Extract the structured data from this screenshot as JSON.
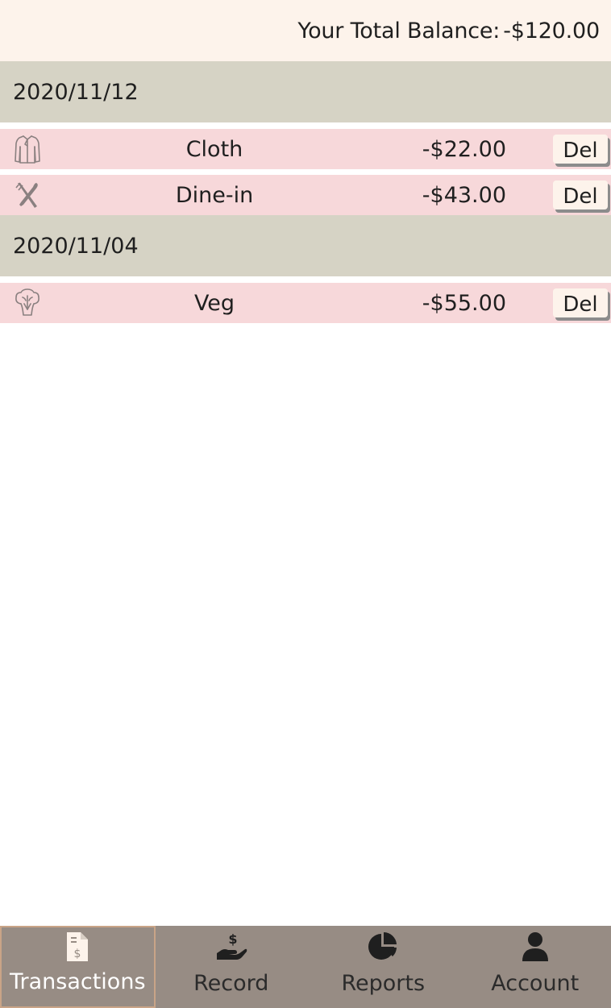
{
  "header": {
    "balance_label": "Your Total Balance:",
    "balance_value": "-$120.00"
  },
  "groups": [
    {
      "date": "2020/11/12",
      "transactions": [
        {
          "icon": "shirt-icon",
          "category": "Cloth",
          "amount": "-$22.00",
          "del_label": "Del"
        },
        {
          "icon": "fork-knife-icon",
          "category": "Dine-in",
          "amount": "-$43.00",
          "del_label": "Del"
        }
      ]
    },
    {
      "date": "2020/11/04",
      "transactions": [
        {
          "icon": "broccoli-icon",
          "category": "Veg",
          "amount": "-$55.00",
          "del_label": "Del"
        }
      ]
    }
  ],
  "nav": {
    "items": [
      {
        "label": "Transactions",
        "icon": "receipt-dollar-icon",
        "active": true
      },
      {
        "label": "Record",
        "icon": "hand-dollar-icon",
        "active": false
      },
      {
        "label": "Reports",
        "icon": "pie-chart-icon",
        "active": false
      },
      {
        "label": "Account",
        "icon": "user-icon",
        "active": false
      }
    ]
  },
  "colors": {
    "header_bg": "#fdf3eb",
    "date_row_bg": "#d6d3c5",
    "transaction_row_bg": "#f7d8da",
    "nav_bg": "#978c84",
    "nav_active_border": "#c9a487"
  }
}
